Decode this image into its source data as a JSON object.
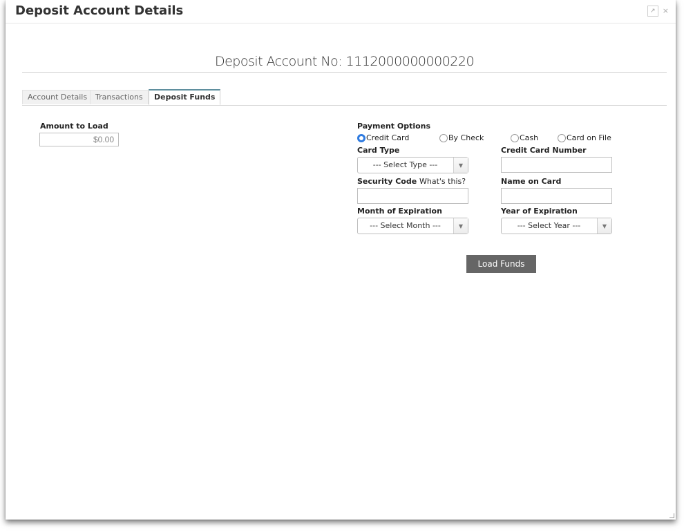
{
  "window": {
    "title": "Deposit Account Details",
    "popout_icon": "↗",
    "close_icon": "×"
  },
  "account": {
    "heading": "Deposit Account No: 1112000000000220"
  },
  "tabs": [
    {
      "label": "Account Details",
      "active": false
    },
    {
      "label": "Transactions",
      "active": false
    },
    {
      "label": "Deposit Funds",
      "active": true
    }
  ],
  "amount": {
    "label": "Amount to Load",
    "value": "$0.00"
  },
  "payment": {
    "label": "Payment Options",
    "options": [
      {
        "label": "Credit Card",
        "checked": true
      },
      {
        "label": "By Check",
        "checked": false
      },
      {
        "label": "Cash",
        "checked": false
      },
      {
        "label": "Card on File",
        "checked": false
      }
    ]
  },
  "card_type": {
    "label": "Card Type",
    "selected": "--- Select Type ---"
  },
  "card_number": {
    "label": "Credit Card Number",
    "value": ""
  },
  "security_code": {
    "label": "Security Code",
    "help_text": "What's this?",
    "value": ""
  },
  "name_on_card": {
    "label": "Name on Card",
    "value": ""
  },
  "month_exp": {
    "label": "Month of Expiration",
    "selected": "--- Select Month ---"
  },
  "year_exp": {
    "label": "Year of Expiration",
    "selected": "--- Select Year ---"
  },
  "actions": {
    "load_funds": "Load Funds"
  },
  "colors": {
    "accent_radio": "#2f7be0",
    "button_bg": "#666666",
    "tab_active_border": "#5f8f9e"
  }
}
